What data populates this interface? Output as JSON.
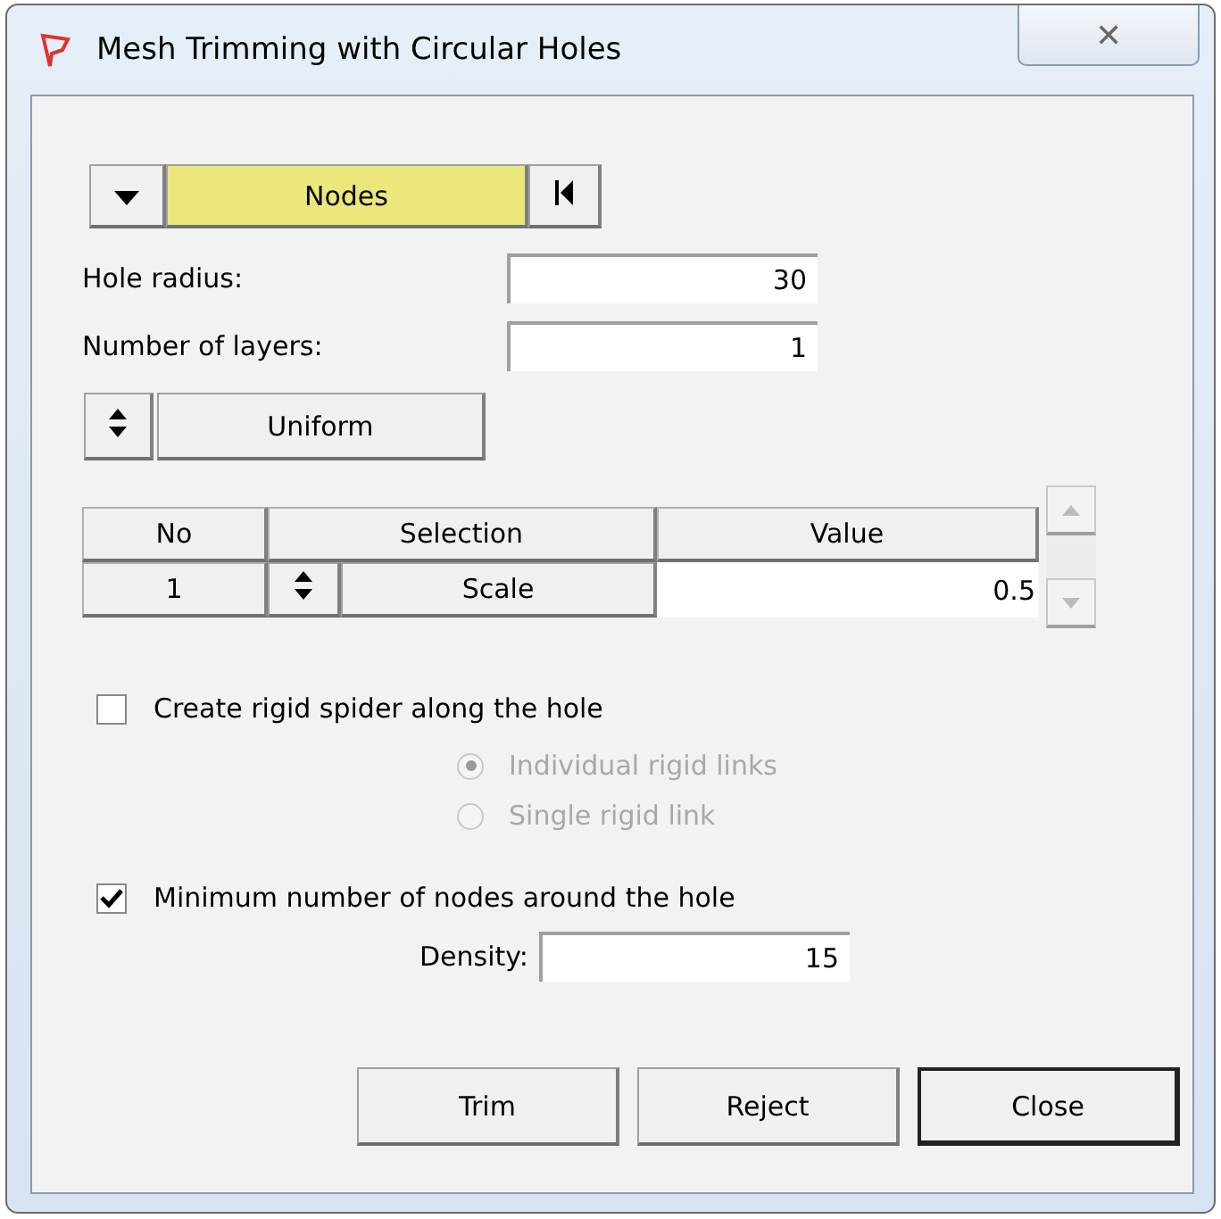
{
  "window": {
    "title": "Mesh Trimming with Circular Holes",
    "close": "✕"
  },
  "entity_selector": {
    "label": "Nodes"
  },
  "fields": [
    {
      "label": "Hole radius:",
      "value": "30"
    },
    {
      "label": "Number of layers:",
      "value": "1"
    }
  ],
  "distribution": {
    "label": "Uniform"
  },
  "table": {
    "columns": [
      "No",
      "Selection",
      "Value"
    ],
    "rows": [
      {
        "no": "1",
        "selection": "Scale",
        "value": "0.5"
      }
    ]
  },
  "spider": {
    "label": "Create rigid spider along the hole",
    "checked": false,
    "options": [
      {
        "label": "Individual rigid links",
        "selected": true,
        "disabled": true
      },
      {
        "label": "Single rigid link",
        "selected": false,
        "disabled": true
      }
    ]
  },
  "min_nodes": {
    "label": "Minimum number of nodes around the hole",
    "checked": true,
    "density_label": "Density:",
    "density": "15"
  },
  "buttons": [
    {
      "label": "Trim",
      "default": false
    },
    {
      "label": "Reject",
      "default": false
    },
    {
      "label": "Close",
      "default": true
    }
  ]
}
